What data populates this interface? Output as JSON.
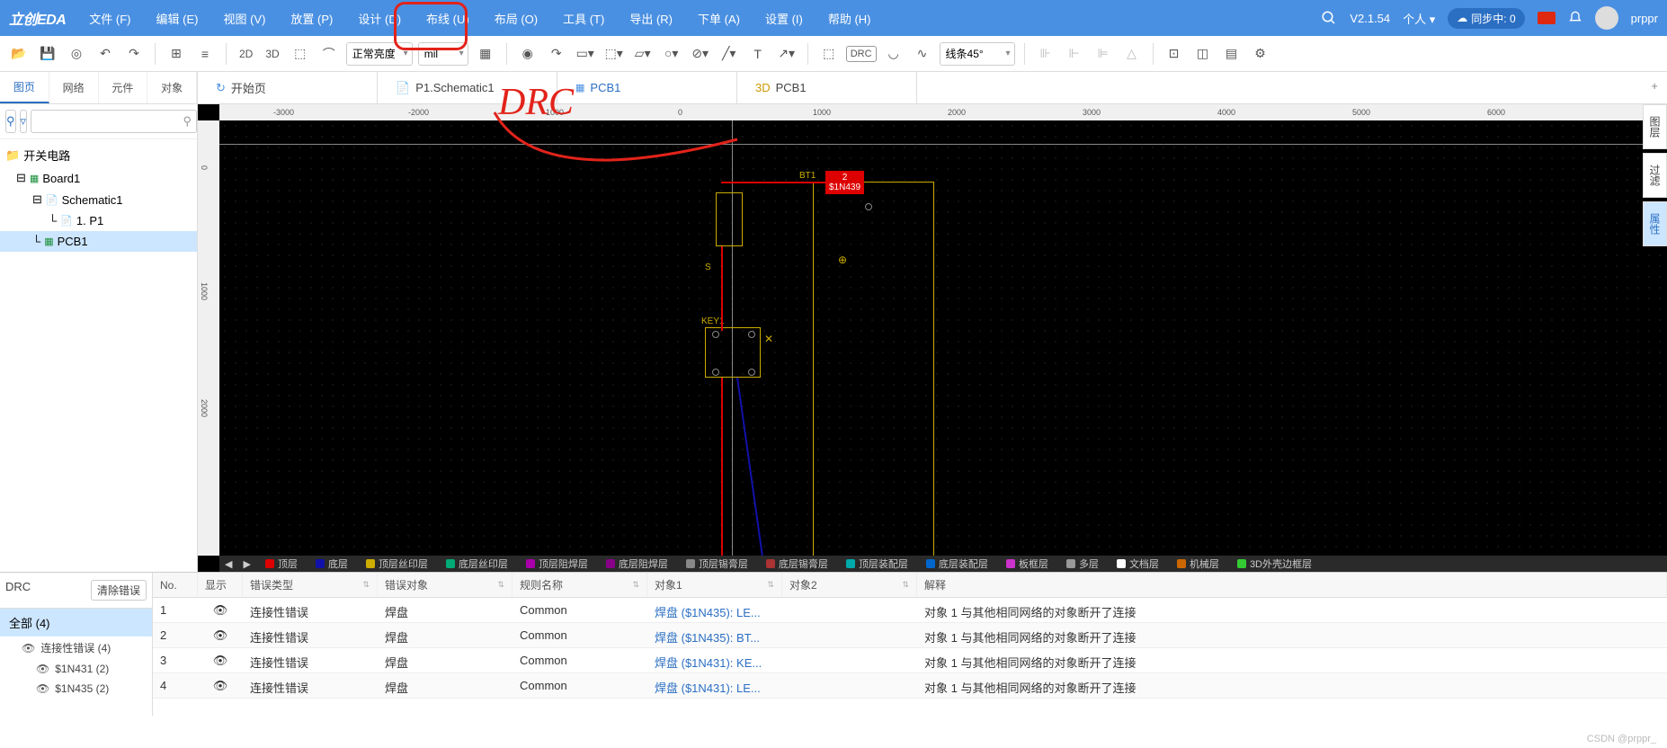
{
  "logo": "立创EDA",
  "menu": [
    "文件 (F)",
    "编辑 (E)",
    "视图 (V)",
    "放置 (P)",
    "设计 (D)",
    "布线 (U)",
    "布局 (O)",
    "工具 (T)",
    "导出 (R)",
    "下单 (A)",
    "设置 (I)",
    "帮助 (H)"
  ],
  "version": "V2.1.54",
  "account": "个人 ▾",
  "sync": "同步中: 0",
  "username": "prppr",
  "toolbar": {
    "d2": "2D",
    "d3": "3D",
    "brightness": "正常亮度",
    "unit": "mil",
    "drc": "DRC",
    "angle": "线条45°"
  },
  "left_tabs": [
    "图页",
    "网络",
    "元件",
    "对象"
  ],
  "doc_tabs": [
    {
      "icon": "↻",
      "label": "开始页"
    },
    {
      "icon": "📄",
      "label": "P1.Schematic1"
    },
    {
      "icon": "▦",
      "label": "PCB1"
    },
    {
      "icon": "3D",
      "label": "PCB1"
    }
  ],
  "tree": {
    "root": "开关电路",
    "board": "Board1",
    "schematic": "Schematic1",
    "page": "1. P1",
    "pcb": "PCB1"
  },
  "ruler_h": [
    "-3000",
    "-2000",
    "-1000",
    "0",
    "1000",
    "2000",
    "3000",
    "4000",
    "5000",
    "6000"
  ],
  "ruler_v": [
    "0",
    "1000",
    "2000"
  ],
  "comp": {
    "bt1": "BT1",
    "s": "S",
    "key1": "KEY1",
    "ref2": "2",
    "net": "$1N439"
  },
  "layers": [
    {
      "c": "#d00",
      "n": "顶层"
    },
    {
      "c": "#11a",
      "n": "底层"
    },
    {
      "c": "#ccad00",
      "n": "顶层丝印层"
    },
    {
      "c": "#0a7",
      "n": "底层丝印层"
    },
    {
      "c": "#a0a",
      "n": "顶层阻焊层"
    },
    {
      "c": "#808",
      "n": "底层阻焊层"
    },
    {
      "c": "#888",
      "n": "顶层锡膏层"
    },
    {
      "c": "#a33",
      "n": "底层锡膏层"
    },
    {
      "c": "#0aa",
      "n": "顶层装配层"
    },
    {
      "c": "#06c",
      "n": "底层装配层"
    },
    {
      "c": "#c3c",
      "n": "板框层"
    },
    {
      "c": "#999",
      "n": "多层"
    },
    {
      "c": "#fff",
      "n": "文档层"
    },
    {
      "c": "#c60",
      "n": "机械层"
    },
    {
      "c": "#3c3",
      "n": "3D外壳边框层"
    }
  ],
  "right": {
    "layers": "图层",
    "filter": "过滤",
    "props": "属性"
  },
  "drc": {
    "title": "DRC",
    "clear": "清除错误",
    "all": "全部 (4)",
    "cat": "连接性错误 (4)",
    "subs": [
      "$1N431 (2)",
      "$1N435 (2)"
    ],
    "cols": {
      "no": "No.",
      "show": "显示",
      "type": "错误类型",
      "obj": "错误对象",
      "rule": "规则名称",
      "o1": "对象1",
      "o2": "对象2",
      "note": "解释"
    },
    "rows": [
      {
        "no": "1",
        "type": "连接性错误",
        "obj": "焊盘",
        "rule": "Common",
        "o1": "焊盘 ($1N435): LE...",
        "note": "对象 1 与其他相同网络的对象断开了连接"
      },
      {
        "no": "2",
        "type": "连接性错误",
        "obj": "焊盘",
        "rule": "Common",
        "o1": "焊盘 ($1N435): BT...",
        "note": "对象 1 与其他相同网络的对象断开了连接"
      },
      {
        "no": "3",
        "type": "连接性错误",
        "obj": "焊盘",
        "rule": "Common",
        "o1": "焊盘 ($1N431): KE...",
        "note": "对象 1 与其他相同网络的对象断开了连接"
      },
      {
        "no": "4",
        "type": "连接性错误",
        "obj": "焊盘",
        "rule": "Common",
        "o1": "焊盘 ($1N431): LE...",
        "note": "对象 1 与其他相同网络的对象断开了连接"
      }
    ]
  },
  "annot": "DRC",
  "watermark": "CSDN @prppr_"
}
